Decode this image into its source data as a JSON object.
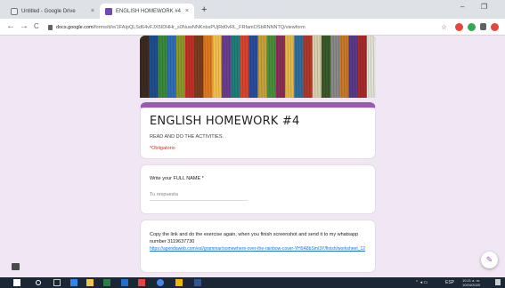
{
  "browser": {
    "tabs": [
      {
        "title": "Untitled - Google Drive",
        "close": "×"
      },
      {
        "title": "ENGLISH HOMEWORK #4",
        "close": "×"
      }
    ],
    "new_tab": "+",
    "minimize": "–",
    "restore": "❐",
    "url_domain": "docs.google.com",
    "url_path": "/forms/d/e/1FAIpQLSd64vFJX5IDHHr_s0NuwNNKnbsPUjRd0vRL_FRfamOSbRNNNTQ/viewform",
    "nav": {
      "back": "←",
      "forward": "→",
      "reload": "C"
    },
    "star": "☆"
  },
  "form": {
    "title": "ENGLISH HOMEWORK #4",
    "description": "READ AND DO THE ACTIVITIES.",
    "required_note": "*Obligatorio",
    "question": {
      "label": "Write your FULL NAME *",
      "placeholder": "Tu respuesta"
    },
    "instruction": {
      "text": "Copy the link and do the exercise again, when you finish screenshot and send it to my whatsapp number 3119637730",
      "link": "https://agendaweb.com/esl/grammar/somewhere-over-the-rainbow-cover-YH9A8bSmI3Y/finish/worksheet_12"
    },
    "fab": "✎"
  },
  "taskbar": {
    "language": "ESP",
    "time": "10:21 a. m.",
    "date": "10/04/2020"
  },
  "colors": {
    "accent": "#9b59b6",
    "page_bg": "#f1e6f3",
    "required": "#d93025",
    "link": "#1a73e8"
  },
  "header_image": {
    "description_icon": "colored-yarn-icon",
    "stripe_colors": [
      "#3d2b1f",
      "#1f4f8f",
      "#3c8a3b",
      "#2e6fb5",
      "#8c9a2a",
      "#c03028",
      "#7a3e1f",
      "#e07a1f",
      "#f2c14e",
      "#6b3f8f",
      "#1f7f7a",
      "#d9452f",
      "#2a4d9b",
      "#c8a23a",
      "#4a8f3a",
      "#8b2f5a",
      "#e6b84a",
      "#2f6f9f",
      "#b2382a",
      "#d9d1b0",
      "#3a5a2a",
      "#8a8a8a",
      "#c77a2a",
      "#5a3a8a",
      "#a82a2a",
      "#e3e3d7"
    ]
  }
}
